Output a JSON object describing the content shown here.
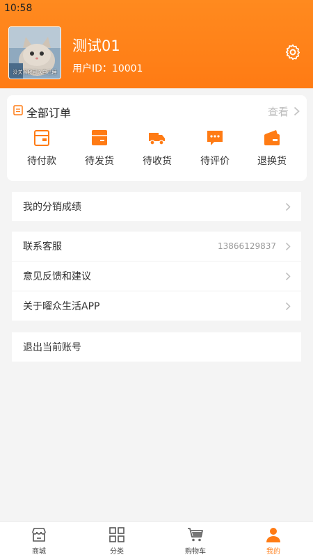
{
  "status_bar": {
    "time": "10:58"
  },
  "profile": {
    "avatar_caption": "没关系我可以自己睡",
    "name": "测试01",
    "user_id": "用户ID：10001"
  },
  "orders": {
    "title": "全部订单",
    "view_all": "查看",
    "items": [
      {
        "label": "待付款",
        "icon": "wallet-icon"
      },
      {
        "label": "待发货",
        "icon": "box-icon"
      },
      {
        "label": "待收货",
        "icon": "truck-icon"
      },
      {
        "label": "待评价",
        "icon": "comment-icon"
      },
      {
        "label": "退换货",
        "icon": "return-icon"
      }
    ]
  },
  "menu": {
    "distribution": "我的分销成绩",
    "contact": {
      "label": "联系客服",
      "phone": "13866129837"
    },
    "feedback": "意见反馈和建议",
    "about": "关于曜众生活APP",
    "logout": "退出当前账号"
  },
  "tabbar": {
    "items": [
      {
        "label": "商城",
        "icon": "store-icon"
      },
      {
        "label": "分类",
        "icon": "grid-icon"
      },
      {
        "label": "购物车",
        "icon": "cart-icon"
      },
      {
        "label": "我的",
        "icon": "user-icon",
        "active": true
      }
    ]
  },
  "colors": {
    "accent": "#ff7b14",
    "background": "#f4f4f4"
  }
}
